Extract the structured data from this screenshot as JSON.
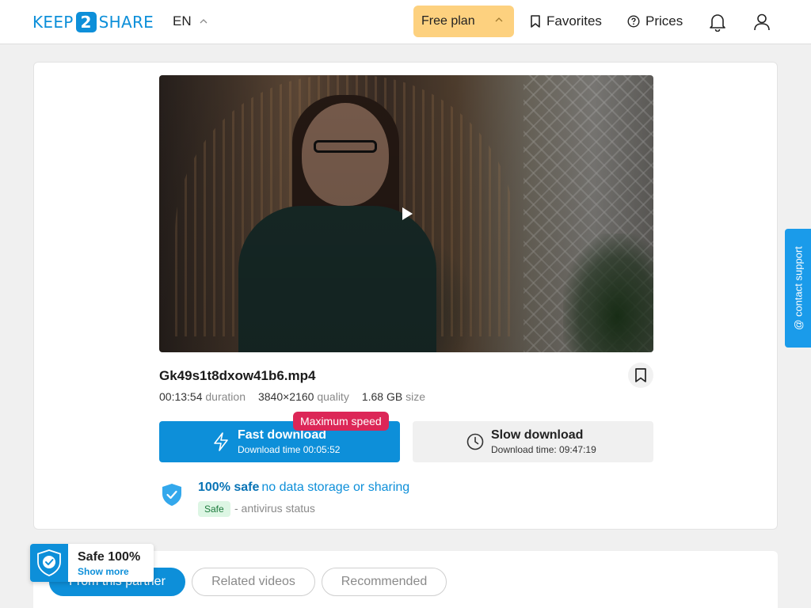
{
  "header": {
    "logo": {
      "prefix": "KEEP",
      "number": "2",
      "suffix": "SHARE"
    },
    "language": "EN",
    "plan_label": "Free plan",
    "favorites_label": "Favorites",
    "prices_label": "Prices"
  },
  "file": {
    "name": "Gk49s1t8dxow41b6.mp4",
    "duration": "00:13:54",
    "duration_label": "duration",
    "quality": "3840×2160",
    "quality_label": "quality",
    "size": "1.68 GB",
    "size_label": "size"
  },
  "downloads": {
    "fast": {
      "title": "Fast download",
      "subtitle": "Download time 00:05:52",
      "badge": "Maximum speed"
    },
    "slow": {
      "title": "Slow download",
      "subtitle": "Download time: 09:47:19"
    }
  },
  "safety": {
    "headline": "100% safe",
    "detail": "no data storage or sharing",
    "tag": "Safe",
    "status": "- antivirus status"
  },
  "tabs": [
    "From this partner",
    "Related videos",
    "Recommended"
  ],
  "safe_badge": {
    "title": "Safe 100%",
    "link": "Show more"
  },
  "support_label": "@ contact support",
  "colors": {
    "accent": "#0d8fd9",
    "plan": "#fdd17f",
    "badge": "#dc2657"
  }
}
